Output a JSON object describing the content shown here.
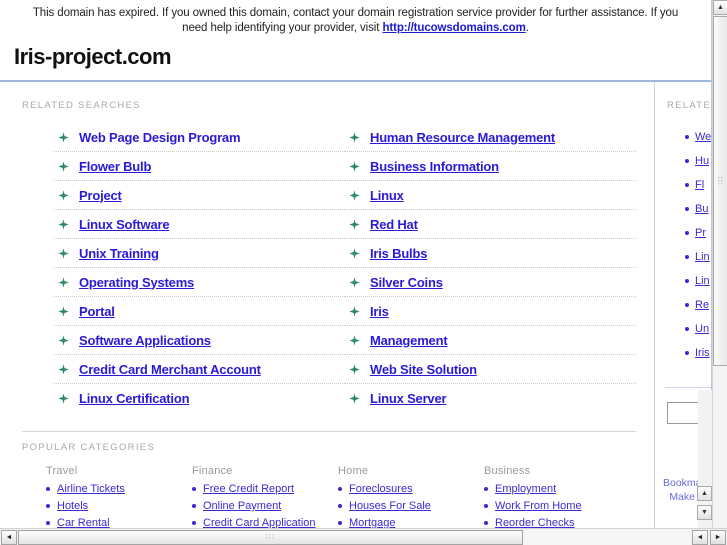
{
  "notice": {
    "text_before": "This domain has expired. If you owned this domain, contact your domain registration service provider for further assistance. If you need help identifying your provider, visit ",
    "link_text": "http://tucowsdomains.com",
    "text_after": "."
  },
  "header": {
    "domain_title": "Iris-project.com"
  },
  "main": {
    "related_searches_label": "RELATED SEARCHES",
    "related_searches_left": [
      "Web Page Design Program",
      "Flower Bulb",
      "Project",
      "Linux Software",
      "Unix Training",
      "Operating Systems",
      "Portal",
      "Software Applications",
      "Credit Card Merchant Account",
      "Linux Certification"
    ],
    "related_searches_right": [
      "Human Resource Management",
      "Business Information",
      "Linux",
      "Red Hat",
      "Iris Bulbs",
      "Silver Coins",
      "Iris",
      "Management",
      "Web Site Solution",
      "Linux Server"
    ],
    "popular_categories_label": "POPULAR CATEGORIES",
    "categories": [
      {
        "heading": "Travel",
        "links": [
          "Airline Tickets",
          "Hotels",
          "Car Rental"
        ]
      },
      {
        "heading": "Finance",
        "links": [
          "Free Credit Report",
          "Online Payment",
          "Credit Card Application"
        ]
      },
      {
        "heading": "Home",
        "links": [
          "Foreclosures",
          "Houses For Sale",
          "Mortgage"
        ]
      },
      {
        "heading": "Business",
        "links": [
          "Employment",
          "Work From Home",
          "Reorder Checks"
        ]
      }
    ]
  },
  "sidebar": {
    "label": "RELATED",
    "items": [
      "We",
      "Hu",
      "Fl",
      "Bu",
      "Pr",
      "Lin",
      "Lin",
      "Re",
      "Un",
      "Iris"
    ],
    "search_value": "",
    "footer_links": [
      "Bookmark",
      "Make thi"
    ]
  },
  "scrollbars": {
    "up_arrow": "▲",
    "down_arrow": "▼",
    "left_arrow": "◄",
    "right_arrow": "►"
  },
  "colors": {
    "link_blue": "#2a1ad8",
    "rule_blue": "#9fb8dd",
    "label_grey": "#a8a8a8",
    "star_green": "#2e8b6f"
  }
}
